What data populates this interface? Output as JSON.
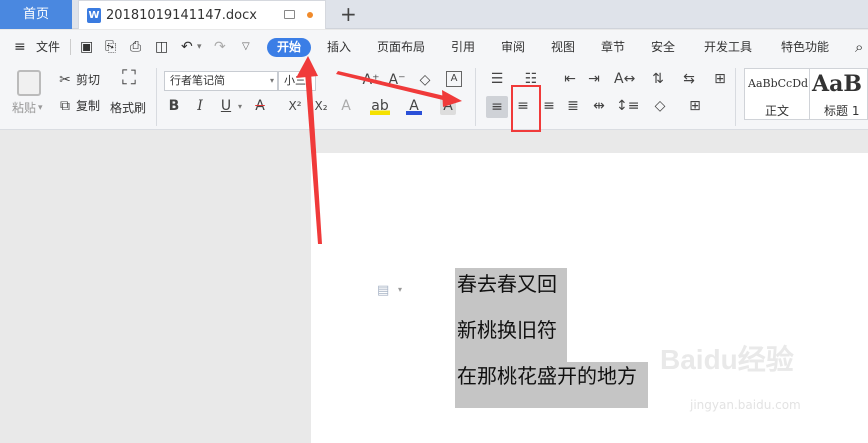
{
  "tabbar": {
    "home_label": "首页",
    "doc_icon": "W",
    "doc_name": "20181019141147.docx",
    "new_tab": "+"
  },
  "menubar": {
    "file_label": "文件",
    "tabs": [
      "开始",
      "插入",
      "页面布局",
      "引用",
      "审阅",
      "视图",
      "章节",
      "安全",
      "开发工具",
      "特色功能"
    ]
  },
  "ribbon": {
    "paste_label": "粘贴",
    "cut_label": "剪切",
    "copy_label": "复制",
    "format_painter_label": "格式刷",
    "font_name": "行者笔记简",
    "font_size": "小三",
    "bold": "B",
    "italic": "I",
    "underline": "U",
    "strike": "A",
    "superscript": "X²",
    "subscript": "X₂",
    "styles": [
      {
        "preview": "AaBbCcDd",
        "label": "正文"
      },
      {
        "preview": "AaB",
        "label": "标题 1"
      }
    ]
  },
  "document": {
    "lines": [
      "春去春又回",
      "新桃换旧符",
      "在那桃花盛开的地方"
    ]
  },
  "watermark": {
    "brand": "Baidu经验",
    "url": "jingyan.baidu.com"
  },
  "colors": {
    "accent": "#3b7ee6",
    "annotation": "#f03a3a",
    "selection": "#c5c5c5",
    "tab_home": "#4a88e0"
  },
  "annotations": {
    "highlighted_button": "align-center-button",
    "highlighted_tab": "tab-kaishi"
  }
}
